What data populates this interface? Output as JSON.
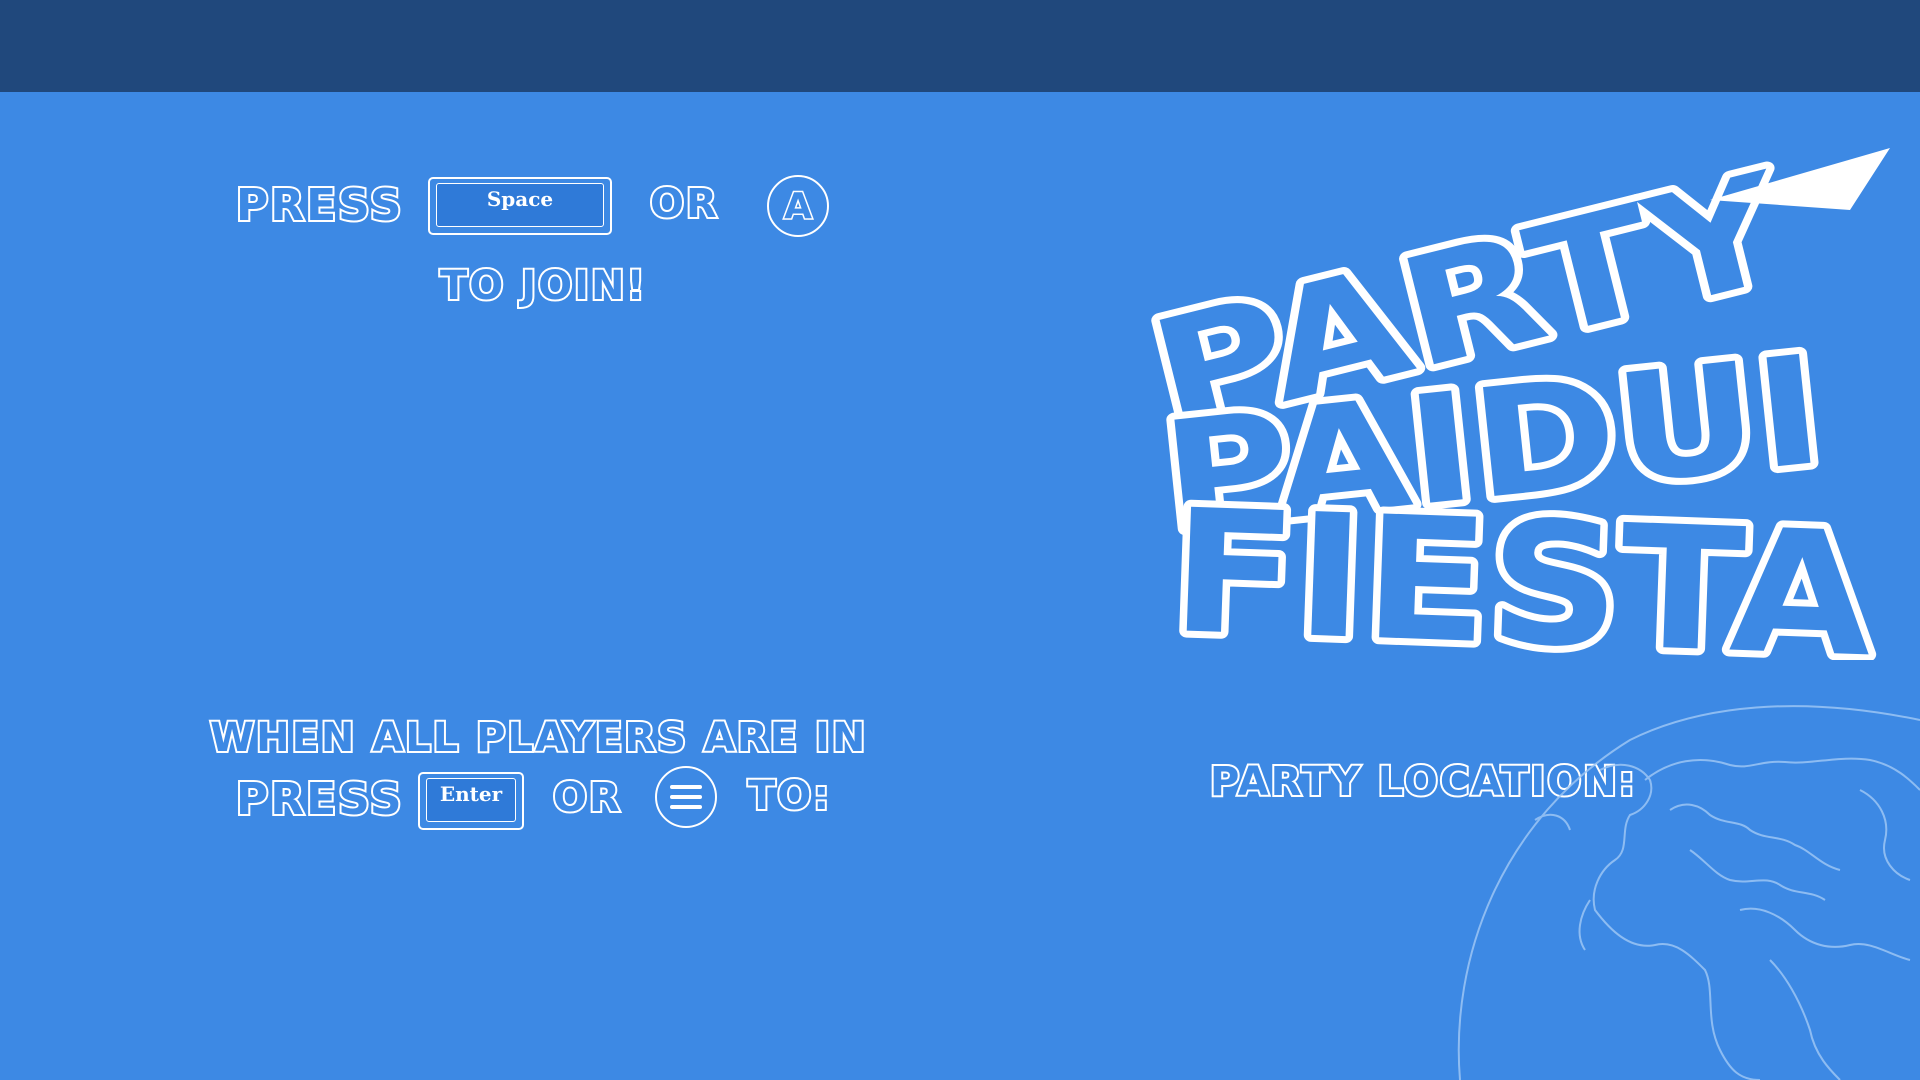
{
  "join_prompt": {
    "press_label": "PRESS",
    "key_label": "Space",
    "or_label": "OR",
    "button_label": "A",
    "to_join_label": "TO JOIN!"
  },
  "start_prompt": {
    "line1": "WHEN ALL PLAYERS ARE IN",
    "press_label": "PRESS",
    "key_label": "Enter",
    "or_label": "OR",
    "button_icon": "menu-icon",
    "to_label": "TO:"
  },
  "logo": {
    "line1": "PARTY",
    "line2": "PAIDUI",
    "line3": "FIESTA"
  },
  "location": {
    "label": "PARTY LOCATION:"
  },
  "colors": {
    "background": "#3d89e4",
    "top_bar": "#20487c",
    "text_outline": "#ffffff"
  }
}
